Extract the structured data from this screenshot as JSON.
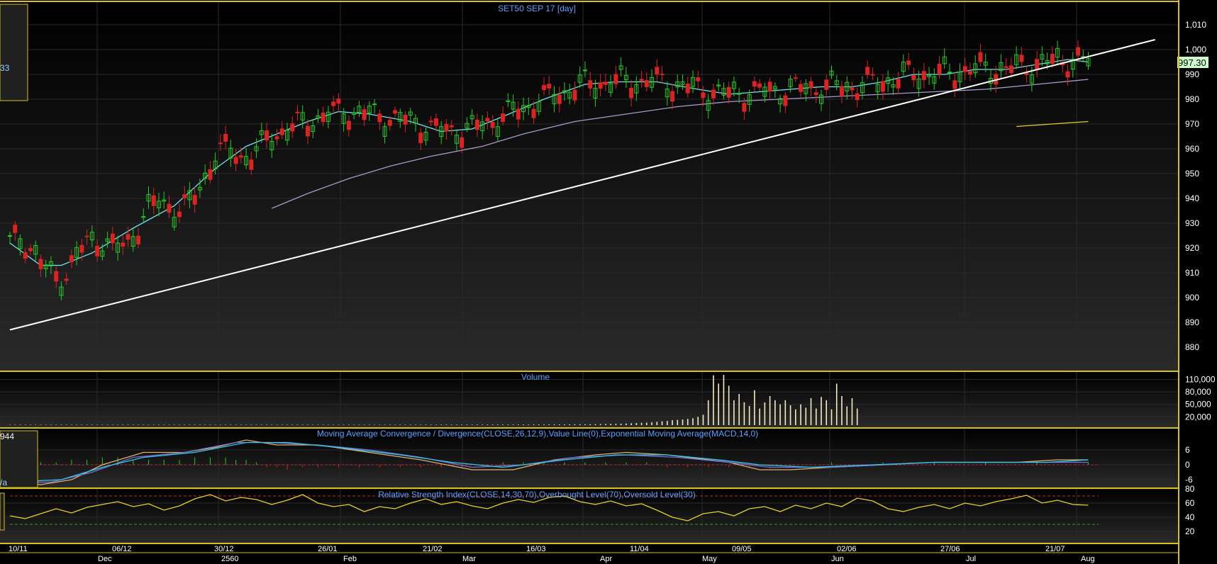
{
  "colors": {
    "background": "#000000",
    "panel_border": "#d8c020",
    "grid": "#2a2a2a",
    "candle_up": "#22cc22",
    "candle_down": "#dd2222",
    "ma_short": "#6fe3f0",
    "ma_long": "#a79acc",
    "trendline": "#ffffff",
    "volume_bar": "#f5ecc0",
    "macd_line": "#e0b070",
    "signal_line": "#7a6fd0",
    "ema_line": "#30c8f0",
    "hist_up": "#22cc22",
    "hist_down": "#dd2222",
    "rsi_line": "#e8d020",
    "overbought": "#cc2222",
    "oversold": "#22aa22",
    "title_text": "#5aa0ff",
    "last_price_tag": "#ccffcc"
  },
  "info_boxes": {
    "price_left_value": "33",
    "macd_left_value": "944",
    "macd_left_label": "/a"
  },
  "chart_data": [
    {
      "panel": "price",
      "type": "candlestick",
      "title": "SET50 SEP 17   [day]",
      "ylim": [
        872,
        1015
      ],
      "y_ticks": [
        880,
        890,
        900,
        910,
        920,
        930,
        940,
        950,
        960,
        970,
        980,
        990,
        1000,
        1010
      ],
      "y_tick_labels": [
        "880",
        "890",
        "900",
        "910",
        "920",
        "930",
        "940",
        "950",
        "960",
        "970",
        "980",
        "990",
        "1,000",
        "1,010"
      ],
      "last_price": "997.30",
      "trendline": [
        [
          0,
          887
        ],
        [
          223,
          1004
        ]
      ],
      "series_note": "daily OHLC candles with two moving averages",
      "moving_average_short": [
        [
          0,
          922
        ],
        [
          6,
          913
        ],
        [
          10,
          913
        ],
        [
          16,
          918
        ],
        [
          24,
          928
        ],
        [
          32,
          937
        ],
        [
          40,
          952
        ],
        [
          46,
          961
        ],
        [
          52,
          966
        ],
        [
          58,
          971
        ],
        [
          64,
          975
        ],
        [
          70,
          974
        ],
        [
          78,
          971
        ],
        [
          84,
          967
        ],
        [
          90,
          968
        ],
        [
          96,
          973
        ],
        [
          104,
          980
        ],
        [
          112,
          986
        ],
        [
          118,
          987
        ],
        [
          126,
          987
        ],
        [
          134,
          984
        ],
        [
          140,
          982
        ],
        [
          146,
          983
        ],
        [
          152,
          984
        ],
        [
          158,
          985
        ],
        [
          164,
          985
        ],
        [
          170,
          987
        ],
        [
          176,
          990
        ],
        [
          182,
          990
        ],
        [
          188,
          992
        ],
        [
          194,
          992
        ],
        [
          200,
          994
        ],
        [
          206,
          996
        ],
        [
          210,
          995
        ]
      ],
      "moving_average_long": [
        [
          51,
          936
        ],
        [
          58,
          942
        ],
        [
          66,
          948
        ],
        [
          74,
          953
        ],
        [
          82,
          957
        ],
        [
          92,
          961
        ],
        [
          100,
          966
        ],
        [
          110,
          971
        ],
        [
          120,
          974
        ],
        [
          130,
          977
        ],
        [
          140,
          979
        ],
        [
          150,
          980
        ],
        [
          160,
          981
        ],
        [
          170,
          982
        ],
        [
          180,
          983
        ],
        [
          190,
          984
        ],
        [
          200,
          986
        ],
        [
          210,
          988
        ]
      ],
      "extra_segment": [
        [
          196,
          969
        ],
        [
          210,
          971
        ]
      ]
    },
    {
      "panel": "volume",
      "type": "bar",
      "title": "Volume",
      "y_tick_labels": [
        "110,000",
        "80,000",
        "50,000",
        "20,000"
      ],
      "y_ticks": [
        110000,
        80000,
        50000,
        20000
      ],
      "ylim": [
        0,
        128000
      ],
      "values": [
        800,
        800,
        800,
        800,
        800,
        800,
        800,
        800,
        800,
        800,
        800,
        800,
        800,
        800,
        800,
        800,
        800,
        800,
        800,
        800,
        800,
        800,
        800,
        800,
        800,
        800,
        800,
        800,
        800,
        800,
        800,
        800,
        800,
        800,
        800,
        800,
        800,
        800,
        800,
        800,
        800,
        800,
        800,
        800,
        800,
        800,
        800,
        800,
        800,
        800,
        800,
        800,
        800,
        800,
        800,
        800,
        800,
        800,
        800,
        800,
        800,
        800,
        800,
        800,
        800,
        800,
        800,
        800,
        800,
        900,
        900,
        900,
        900,
        900,
        900,
        900,
        900,
        900,
        900,
        900,
        900,
        1000,
        1000,
        1000,
        1000,
        1000,
        1000,
        1000,
        1000,
        1000,
        1000,
        1200,
        1200,
        1200,
        1200,
        1200,
        1200,
        1300,
        1300,
        1300,
        1400,
        1400,
        1500,
        1500,
        1500,
        1600,
        1600,
        1700,
        1700,
        1800,
        1900,
        2000,
        2000,
        2200,
        2300,
        2500,
        2700,
        3000,
        3200,
        3500,
        4000,
        4500,
        5000,
        5500,
        6000,
        7000,
        8000,
        9000,
        10000,
        12000,
        12500,
        13500,
        15000,
        16500,
        20000,
        25000,
        60000,
        120000,
        100000,
        121000,
        95000,
        60000,
        75000,
        55000,
        46000,
        84000,
        40000,
        55000,
        70000,
        60000,
        50000,
        60000,
        48000,
        38000,
        50000,
        42000,
        65000,
        40000,
        68000,
        60000,
        38000,
        100000,
        70000,
        45000,
        65000,
        40000
      ],
      "x_range": [
        0,
        212
      ]
    },
    {
      "panel": "macd",
      "type": "line",
      "title": "Moving Average Convergence / Divergence(CLOSE,26,12,9),Value Line(0),Exponential Moving Average(MACD,14,0)",
      "ylim": [
        -12,
        12
      ],
      "y_ticks": [
        6,
        0,
        -6
      ],
      "y_tick_labels": [
        "6",
        "0",
        "-6"
      ],
      "zero_line": 0,
      "series": [
        {
          "role": "macd",
          "values": [
            [
              0,
              -6
            ],
            [
              6,
              -8
            ],
            [
              12,
              -6
            ],
            [
              18,
              0
            ],
            [
              26,
              5
            ],
            [
              34,
              5
            ],
            [
              40,
              7
            ],
            [
              46,
              10
            ],
            [
              52,
              8
            ],
            [
              60,
              8
            ],
            [
              70,
              5
            ],
            [
              80,
              2
            ],
            [
              90,
              -2
            ],
            [
              98,
              -2
            ],
            [
              106,
              2
            ],
            [
              114,
              4
            ],
            [
              120,
              5
            ],
            [
              128,
              4
            ],
            [
              136,
              2
            ],
            [
              140,
              1
            ],
            [
              146,
              -2
            ],
            [
              152,
              -2
            ],
            [
              160,
              -1
            ],
            [
              170,
              0
            ],
            [
              180,
              1
            ],
            [
              190,
              1
            ],
            [
              196,
              1
            ],
            [
              204,
              2
            ],
            [
              210,
              2
            ]
          ]
        },
        {
          "role": "signal",
          "values": [
            [
              0,
              -7
            ],
            [
              8,
              -7
            ],
            [
              16,
              -3
            ],
            [
              24,
              3
            ],
            [
              34,
              5
            ],
            [
              44,
              9
            ],
            [
              50,
              9
            ],
            [
              60,
              8
            ],
            [
              70,
              6
            ],
            [
              80,
              3
            ],
            [
              90,
              -1
            ],
            [
              100,
              0
            ],
            [
              110,
              3
            ],
            [
              120,
              4
            ],
            [
              130,
              3
            ],
            [
              140,
              1
            ],
            [
              148,
              -1
            ],
            [
              160,
              -1
            ],
            [
              170,
              0
            ],
            [
              180,
              1
            ],
            [
              190,
              1
            ],
            [
              200,
              1
            ],
            [
              210,
              1
            ]
          ]
        },
        {
          "role": "ema",
          "values": [
            [
              0,
              -7
            ],
            [
              10,
              -6
            ],
            [
              18,
              -1
            ],
            [
              26,
              3
            ],
            [
              36,
              5
            ],
            [
              46,
              9
            ],
            [
              54,
              9
            ],
            [
              64,
              7
            ],
            [
              76,
              4
            ],
            [
              86,
              1
            ],
            [
              96,
              -1
            ],
            [
              108,
              2
            ],
            [
              118,
              4
            ],
            [
              128,
              4
            ],
            [
              138,
              2
            ],
            [
              146,
              0
            ],
            [
              156,
              -1
            ],
            [
              168,
              0
            ],
            [
              180,
              1
            ],
            [
              192,
              1
            ],
            [
              202,
              1
            ],
            [
              210,
              2
            ]
          ]
        }
      ],
      "histogram": [
        [
          0,
          -1
        ],
        [
          3,
          -1
        ],
        [
          6,
          1
        ],
        [
          9,
          1
        ],
        [
          12,
          2
        ],
        [
          15,
          2
        ],
        [
          18,
          3
        ],
        [
          21,
          3
        ],
        [
          24,
          2
        ],
        [
          27,
          2
        ],
        [
          30,
          2
        ],
        [
          33,
          2
        ],
        [
          36,
          3
        ],
        [
          39,
          3
        ],
        [
          42,
          3
        ],
        [
          44,
          2
        ],
        [
          46,
          2
        ],
        [
          48,
          1
        ],
        [
          50,
          -1
        ],
        [
          52,
          -1
        ],
        [
          54,
          -2
        ],
        [
          57,
          -1
        ],
        [
          60,
          -1
        ],
        [
          64,
          -1
        ],
        [
          68,
          -1
        ],
        [
          72,
          -1
        ],
        [
          76,
          -1
        ],
        [
          80,
          -1
        ],
        [
          84,
          -1
        ],
        [
          88,
          -1
        ],
        [
          92,
          -1
        ],
        [
          96,
          1
        ],
        [
          100,
          1
        ],
        [
          104,
          1
        ],
        [
          108,
          1
        ],
        [
          112,
          1
        ],
        [
          116,
          1
        ],
        [
          120,
          1
        ],
        [
          124,
          1
        ],
        [
          128,
          -1
        ],
        [
          132,
          -1
        ],
        [
          136,
          -1
        ],
        [
          140,
          -1
        ],
        [
          144,
          -1
        ],
        [
          148,
          -1
        ],
        [
          152,
          -1
        ],
        [
          160,
          1
        ],
        [
          170,
          1
        ],
        [
          180,
          1
        ],
        [
          190,
          1
        ],
        [
          200,
          1
        ],
        [
          210,
          1
        ]
      ],
      "x_range": [
        0,
        212
      ]
    },
    {
      "panel": "rsi",
      "type": "line",
      "title": "Relative Strength Index(CLOSE,14,30,70),Overbought Level(70),Oversold Level(30)",
      "ylim": [
        5,
        95
      ],
      "y_ticks": [
        80,
        60,
        40,
        20
      ],
      "y_tick_labels": [
        "80",
        "60",
        "40",
        "20"
      ],
      "overbought": 70,
      "oversold": 30,
      "values": [
        [
          0,
          42
        ],
        [
          3,
          38
        ],
        [
          6,
          45
        ],
        [
          9,
          52
        ],
        [
          12,
          46
        ],
        [
          15,
          54
        ],
        [
          18,
          58
        ],
        [
          21,
          62
        ],
        [
          24,
          55
        ],
        [
          27,
          59
        ],
        [
          30,
          50
        ],
        [
          33,
          56
        ],
        [
          36,
          66
        ],
        [
          39,
          72
        ],
        [
          42,
          63
        ],
        [
          45,
          68
        ],
        [
          48,
          65
        ],
        [
          51,
          58
        ],
        [
          54,
          64
        ],
        [
          57,
          72
        ],
        [
          60,
          60
        ],
        [
          63,
          55
        ],
        [
          66,
          58
        ],
        [
          69,
          48
        ],
        [
          72,
          55
        ],
        [
          75,
          52
        ],
        [
          78,
          60
        ],
        [
          81,
          66
        ],
        [
          84,
          58
        ],
        [
          87,
          62
        ],
        [
          90,
          56
        ],
        [
          93,
          52
        ],
        [
          96,
          60
        ],
        [
          99,
          65
        ],
        [
          102,
          61
        ],
        [
          105,
          68
        ],
        [
          108,
          70
        ],
        [
          111,
          62
        ],
        [
          114,
          58
        ],
        [
          117,
          63
        ],
        [
          120,
          56
        ],
        [
          123,
          59
        ],
        [
          126,
          50
        ],
        [
          129,
          40
        ],
        [
          132,
          35
        ],
        [
          135,
          45
        ],
        [
          138,
          48
        ],
        [
          141,
          42
        ],
        [
          144,
          52
        ],
        [
          147,
          55
        ],
        [
          150,
          48
        ],
        [
          153,
          57
        ],
        [
          156,
          52
        ],
        [
          159,
          60
        ],
        [
          162,
          55
        ],
        [
          165,
          67
        ],
        [
          168,
          63
        ],
        [
          171,
          52
        ],
        [
          174,
          48
        ],
        [
          177,
          54
        ],
        [
          180,
          58
        ],
        [
          183,
          52
        ],
        [
          186,
          60
        ],
        [
          189,
          56
        ],
        [
          192,
          62
        ],
        [
          195,
          66
        ],
        [
          198,
          71
        ],
        [
          201,
          60
        ],
        [
          204,
          64
        ],
        [
          207,
          58
        ],
        [
          210,
          57
        ]
      ],
      "x_range": [
        0,
        212
      ]
    }
  ],
  "x_axis": {
    "upper_labels": [
      "10/11",
      "06/12",
      "30/12",
      "26/01",
      "21/02",
      "16/03",
      "11/04",
      "09/05",
      "02/06",
      "27/06",
      "21/07"
    ],
    "lower_labels": [
      "Dec",
      "2560",
      "Feb",
      "Mar",
      "Apr",
      "May",
      "Jun",
      "Jul",
      "Aug"
    ]
  }
}
